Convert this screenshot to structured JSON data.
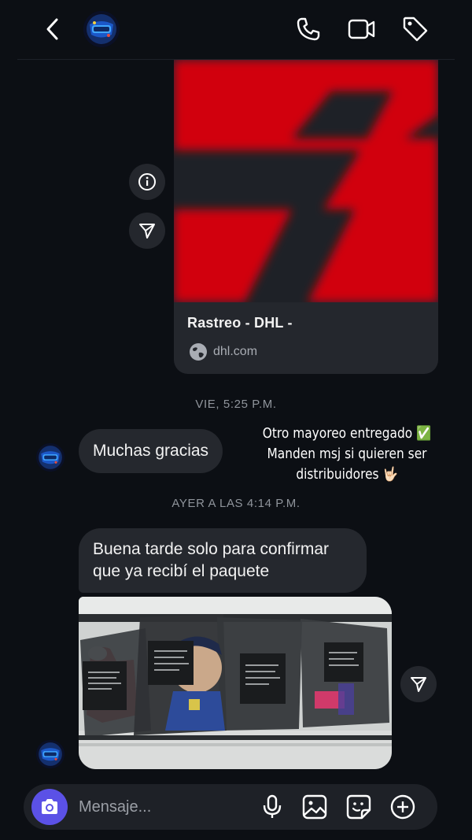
{
  "header": {
    "back_icon": "chevron-left-icon",
    "contact_avatar": "contact-logo-avatar",
    "actions": [
      "phone-icon",
      "video-camera-icon",
      "tag-icon"
    ]
  },
  "link_card": {
    "title": "Rastreo - DHL -",
    "domain": "dhl.com",
    "image_colors": [
      "#d1000f",
      "#1e2127"
    ]
  },
  "timestamps": {
    "first": "VIE, 5:25 P.M.",
    "second": "AYER A LAS 4:14 P.M."
  },
  "messages": {
    "thanks": "Muchas gracias",
    "story_caption": "Otro mayoreo entregado ✅\nManden msj si quieren ser\ndistribuidores 🤟🏻",
    "confirmation": "Buena tarde solo para confirmar\nque ya recibí el paquete"
  },
  "composer": {
    "placeholder": "Mensaje...",
    "camera_color": "#5b51e6",
    "icons": [
      "microphone-icon",
      "gallery-icon",
      "sticker-icon",
      "plus-circle-icon"
    ]
  },
  "colors": {
    "background": "#0c0f14",
    "bubble": "#25282e",
    "accent": "#5b51e6"
  }
}
